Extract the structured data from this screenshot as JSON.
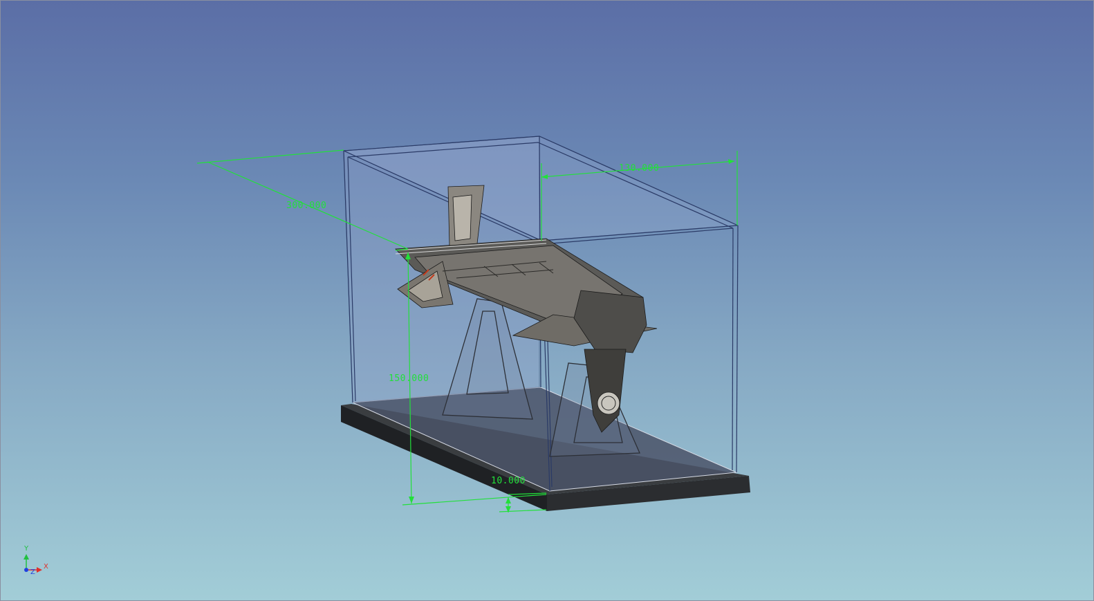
{
  "view": {
    "background_top": "#5b6ea6",
    "background_bottom": "#a2cdd7",
    "dimension_color": "#22e03a",
    "case_edge_color": "#2a3a66"
  },
  "dimensions": {
    "length": "300.000",
    "width": "130.000",
    "height": "150.000",
    "base_thickness": "10.000"
  },
  "axis_triad": {
    "x_label": "X",
    "y_label": "Y",
    "z_label": "Z",
    "x_color": "#e0302a",
    "y_color": "#20c040",
    "z_color": "#2040e0"
  },
  "model": {
    "name_icon": "spaceship-model",
    "stand_icon": "display-stand",
    "case_icon": "display-case"
  }
}
